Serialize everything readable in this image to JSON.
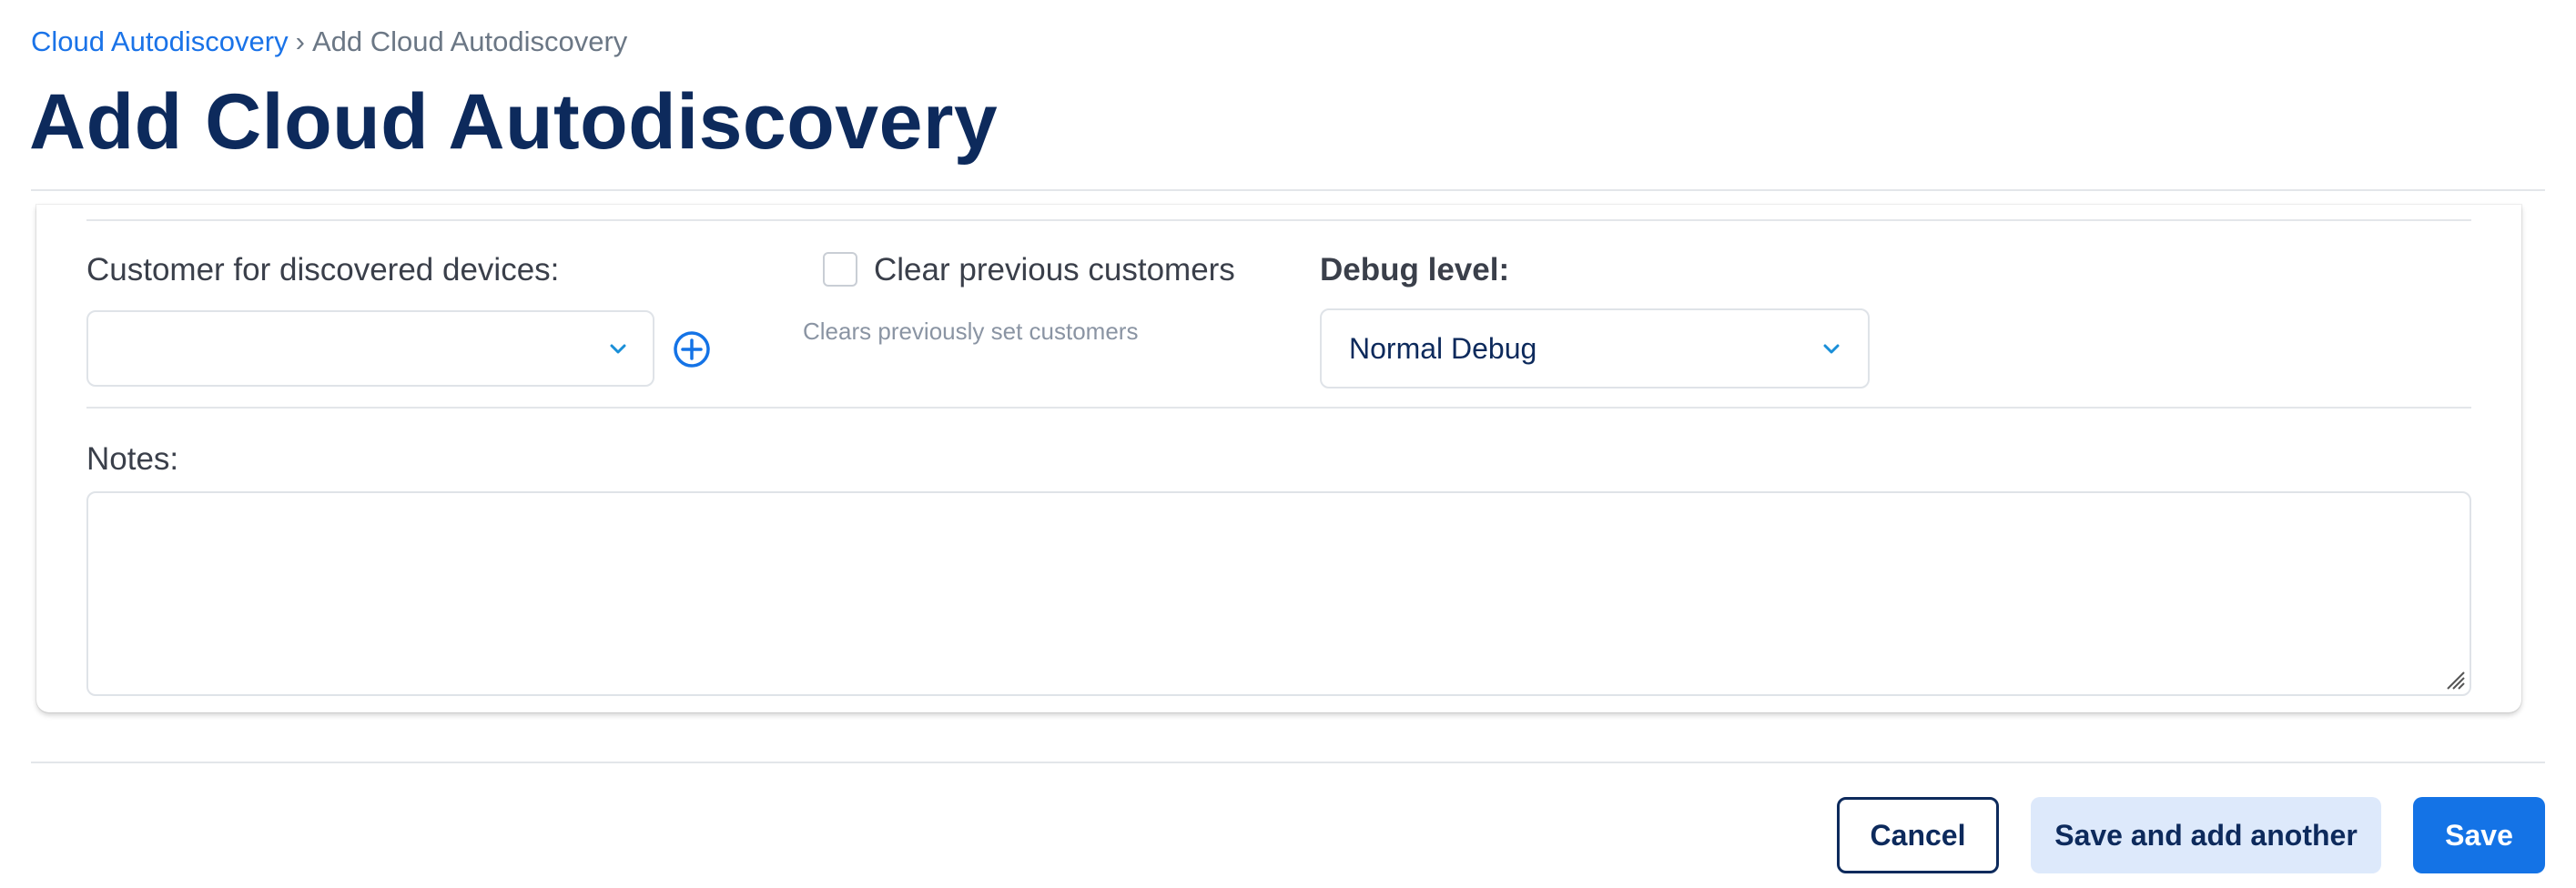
{
  "breadcrumb": {
    "parent": "Cloud Autodiscovery",
    "separator": "›",
    "current": "Add Cloud Autodiscovery"
  },
  "page_title": "Add Cloud Autodiscovery",
  "form": {
    "customer": {
      "label": "Customer for discovered devices:",
      "value": "",
      "add_icon": "plus-circle-icon"
    },
    "clear_customers": {
      "label": "Clear previous customers",
      "checked": false,
      "help": "Clears previously set customers"
    },
    "debug_level": {
      "label": "Debug level:",
      "value": "Normal Debug"
    },
    "notes": {
      "label": "Notes:",
      "value": ""
    }
  },
  "actions": {
    "cancel": "Cancel",
    "save_add_another": "Save and add another",
    "save": "Save"
  },
  "colors": {
    "title": "#0d2a5c",
    "link": "#1a73e8",
    "primary": "#1473e6",
    "secondary_bg": "#dde9fb",
    "chevron": "#1a8fd8"
  }
}
